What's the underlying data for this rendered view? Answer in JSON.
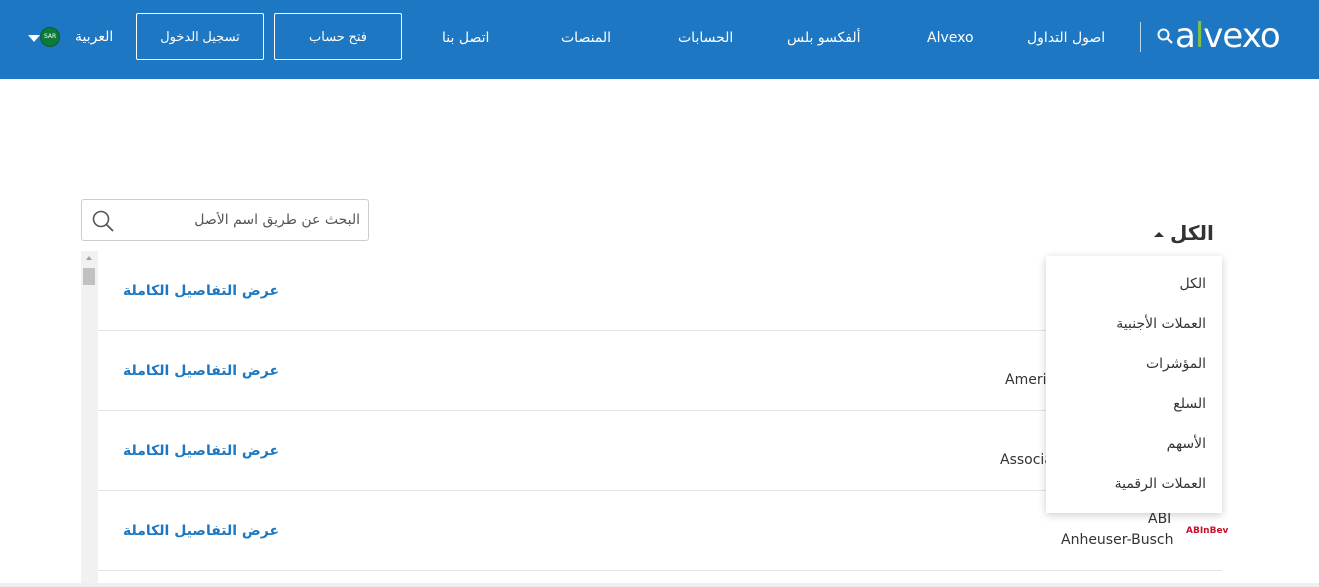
{
  "header": {
    "logo_text": "alvexo",
    "nav": {
      "trading_assets": "اصول التداول",
      "alvexo": "Alvexo",
      "alvexo_plus": "ألفكسو بلس",
      "accounts": "الحسابات",
      "platforms": "المنصات",
      "contact": "اتصل بنا"
    },
    "open_account": "فتح حساب",
    "login": "تسجيل الدخول",
    "language": "العربية",
    "flag_text": "SAR"
  },
  "search": {
    "placeholder": "البحث عن طريق اسم الأصل"
  },
  "filter": {
    "selected": "الكل",
    "options": [
      "الكل",
      "العملات الأجنبية",
      "المؤشرات",
      "السلع",
      "الأسهم",
      "العملات الرقمية"
    ]
  },
  "rows": [
    {
      "details_label": "عرض التفاصيل الكاملة",
      "symbol": "",
      "name": ""
    },
    {
      "details_label": "عرض التفاصيل الكاملة",
      "symbol": "",
      "name": "Ameri"
    },
    {
      "details_label": "عرض التفاصيل الكاملة",
      "symbol": "",
      "name": "Associa"
    },
    {
      "details_label": "عرض التفاصيل الكاملة",
      "symbol": "ABI",
      "name": "Anheuser-Busch",
      "brand": "ABInBev"
    }
  ],
  "colors": {
    "header_bg": "#1d77c2",
    "link": "#1d77c2",
    "logo_accent": "#7cc24a"
  }
}
